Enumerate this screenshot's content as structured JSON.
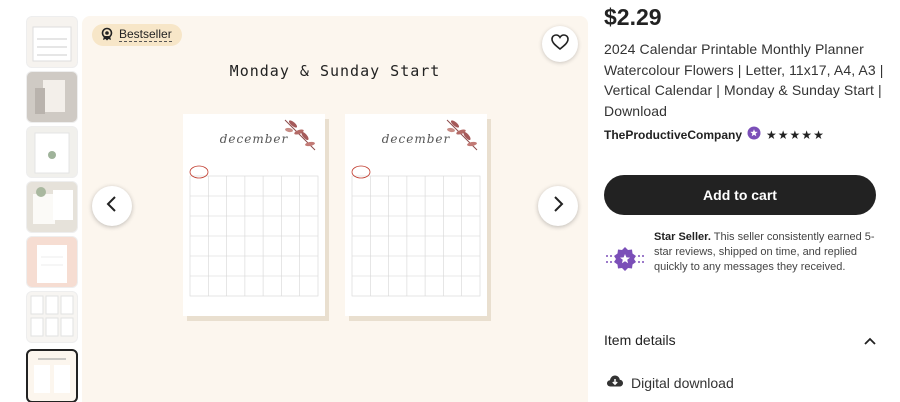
{
  "gallery": {
    "badge": "Bestseller",
    "headline": "Monday & Sunday Start",
    "pages": [
      {
        "month": "december"
      },
      {
        "month": "december"
      }
    ],
    "prev_icon": "chevron-left-icon",
    "next_icon": "chevron-right-icon",
    "favorite_icon": "heart-icon"
  },
  "thumbnails": [
    {
      "id": "thumb-1"
    },
    {
      "id": "thumb-2"
    },
    {
      "id": "thumb-3"
    },
    {
      "id": "thumb-4"
    },
    {
      "id": "thumb-5"
    },
    {
      "id": "thumb-6"
    },
    {
      "id": "thumb-7"
    }
  ],
  "product": {
    "price": "$2.29",
    "title": "2024 Calendar Printable Monthly Planner Watercolour Flowers | Letter, 11x17, A4, A3 | Vertical Calendar | Monday & Sunday Start | Download",
    "shop_name": "TheProductiveCompany",
    "rating_stars": "★★★★★",
    "rating": 5,
    "add_to_cart": "Add to cart",
    "star_seller_title": "Star Seller.",
    "star_seller_text": "This seller consistently earned 5-star reviews, shipped on time, and replied quickly to any messages they received.",
    "item_details": "Item details",
    "digital_download": "Digital download"
  },
  "colors": {
    "accent_dark": "#222222",
    "badge_bg": "#f7e6c8",
    "stage_bg": "#fcf6ee",
    "star_seller_purple": "#7b4fb8"
  }
}
